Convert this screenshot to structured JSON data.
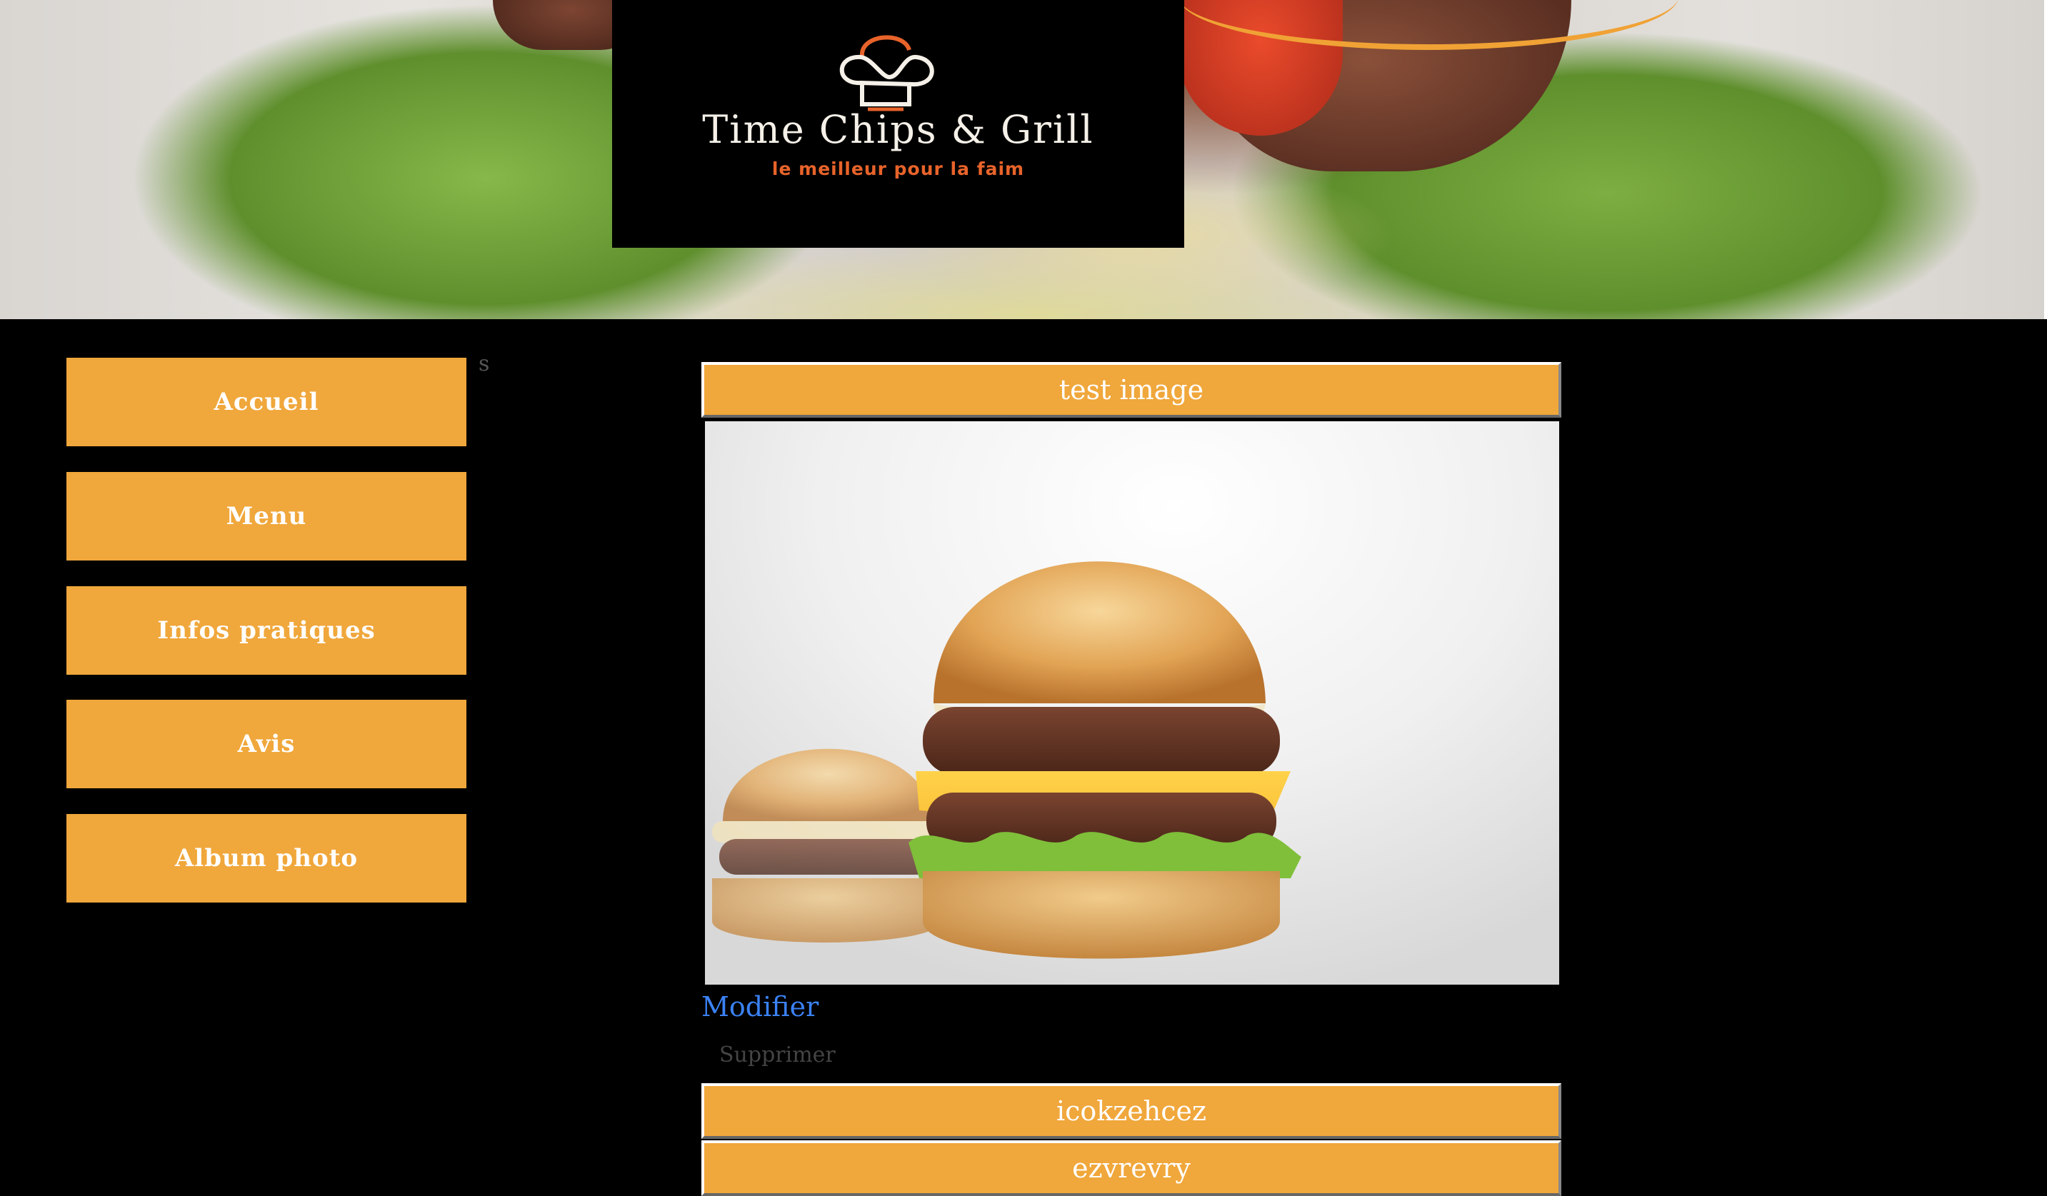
{
  "header": {
    "logo_title": "Time Chips & Grill",
    "logo_tagline": "le meilleur pour la faim",
    "accent": "#e8632a"
  },
  "sidebar": {
    "items": [
      {
        "label": "Accueil"
      },
      {
        "label": "Menu"
      },
      {
        "label": "Infos pratiques"
      },
      {
        "label": "Avis"
      },
      {
        "label": "Album photo"
      }
    ],
    "button_color": "#f0a73b"
  },
  "stray_text": "s",
  "posts": [
    {
      "title": "test image",
      "image": "burger-photo",
      "edit_label": "Modifier",
      "delete_label": "Supprimer"
    },
    {
      "title": "icokzehcez"
    },
    {
      "title": "ezvrevry"
    }
  ],
  "colors": {
    "background": "#000000",
    "link": "#3b82f6"
  }
}
